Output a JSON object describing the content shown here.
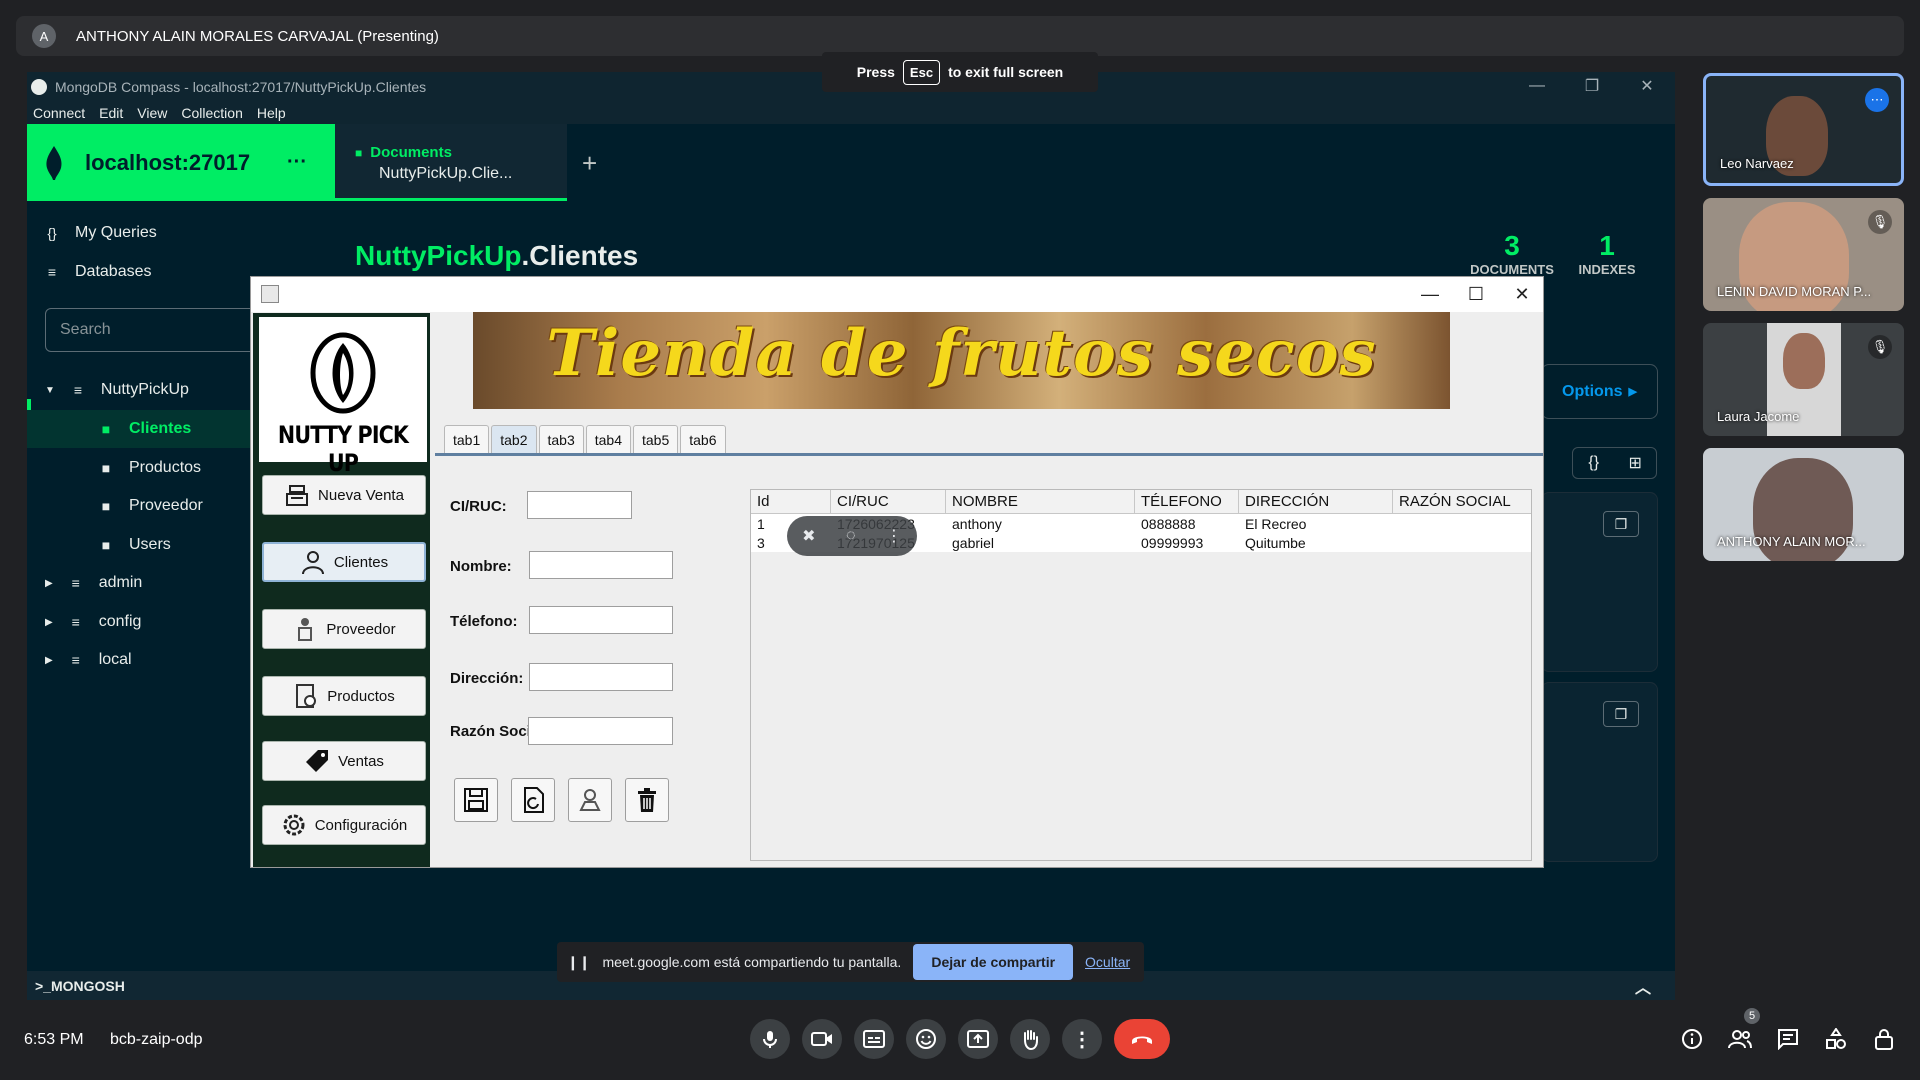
{
  "meet": {
    "presenter_initial": "A",
    "presenter_name": "ANTHONY ALAIN MORALES CARVAJAL (Presenting)",
    "fullscreen_hint_press": "Press",
    "fullscreen_hint_key": "Esc",
    "fullscreen_hint_rest": "to exit full screen",
    "share_banner_text": "meet.google.com está compartiendo tu pantalla.",
    "stop_share_label": "Dejar de compartir",
    "hide_label": "Ocultar",
    "clock": "6:53 PM",
    "meeting_code": "bcb-zaip-odp",
    "people_count": "5",
    "participants": [
      {
        "name": "Leo Narvaez"
      },
      {
        "name": "LENIN DAVID MORAN P..."
      },
      {
        "name": "Laura Jacome"
      },
      {
        "name": "ANTHONY ALAIN MOR..."
      }
    ]
  },
  "compass": {
    "window_title": "MongoDB Compass - localhost:27017/NuttyPickUp.Clientes",
    "menu": [
      "Connect",
      "Edit",
      "View",
      "Collection",
      "Help"
    ],
    "connection": "localhost:27017",
    "connection_more": "···",
    "tab": {
      "title": "Documents",
      "subtitle": "NuttyPickUp.Clie..."
    },
    "sidebar": {
      "my_queries": "My Queries",
      "databases": "Databases",
      "search_placeholder": "Search",
      "db_nutty": "NuttyPickUp",
      "collections": [
        "Clientes",
        "Productos",
        "Proveedor",
        "Users"
      ],
      "other_dbs": [
        "admin",
        "config",
        "local"
      ]
    },
    "collection_db": "NuttyPickUp",
    "collection_name": ".Clientes",
    "stats": {
      "documents_count": "3",
      "documents_label": "DOCUMENTS",
      "indexes_count": "1",
      "indexes_label": "INDEXES"
    },
    "options_label": "Options",
    "mongosh_label": ">_MONGOSH"
  },
  "app": {
    "brand": "NUTTY PICK UP",
    "banner_text": "Tienda de frutos secos",
    "nav": [
      "Nueva Venta",
      "Clientes",
      "Proveedor",
      "Productos",
      "Ventas",
      "Configuración"
    ],
    "tabs": [
      "tab1",
      "tab2",
      "tab3",
      "tab4",
      "tab5",
      "tab6"
    ],
    "active_tab": "tab2",
    "form": {
      "ci_label": "CI/RUC:",
      "nombre_label": "Nombre:",
      "telefono_label": "Télefono:",
      "direccion_label": "Dirección:",
      "razon_label": "Razón Social:"
    },
    "table": {
      "columns": [
        "Id",
        "CI/RUC",
        "NOMBRE",
        "TÉLEFONO",
        "DIRECCIÓN",
        "RAZÓN SOCIAL"
      ],
      "rows": [
        [
          "1",
          "1726062223",
          "anthony",
          "0888888",
          "El Recreo",
          ""
        ],
        [
          "3",
          "1721970125",
          "gabriel",
          "09999993",
          "Quitumbe",
          ""
        ]
      ]
    }
  }
}
